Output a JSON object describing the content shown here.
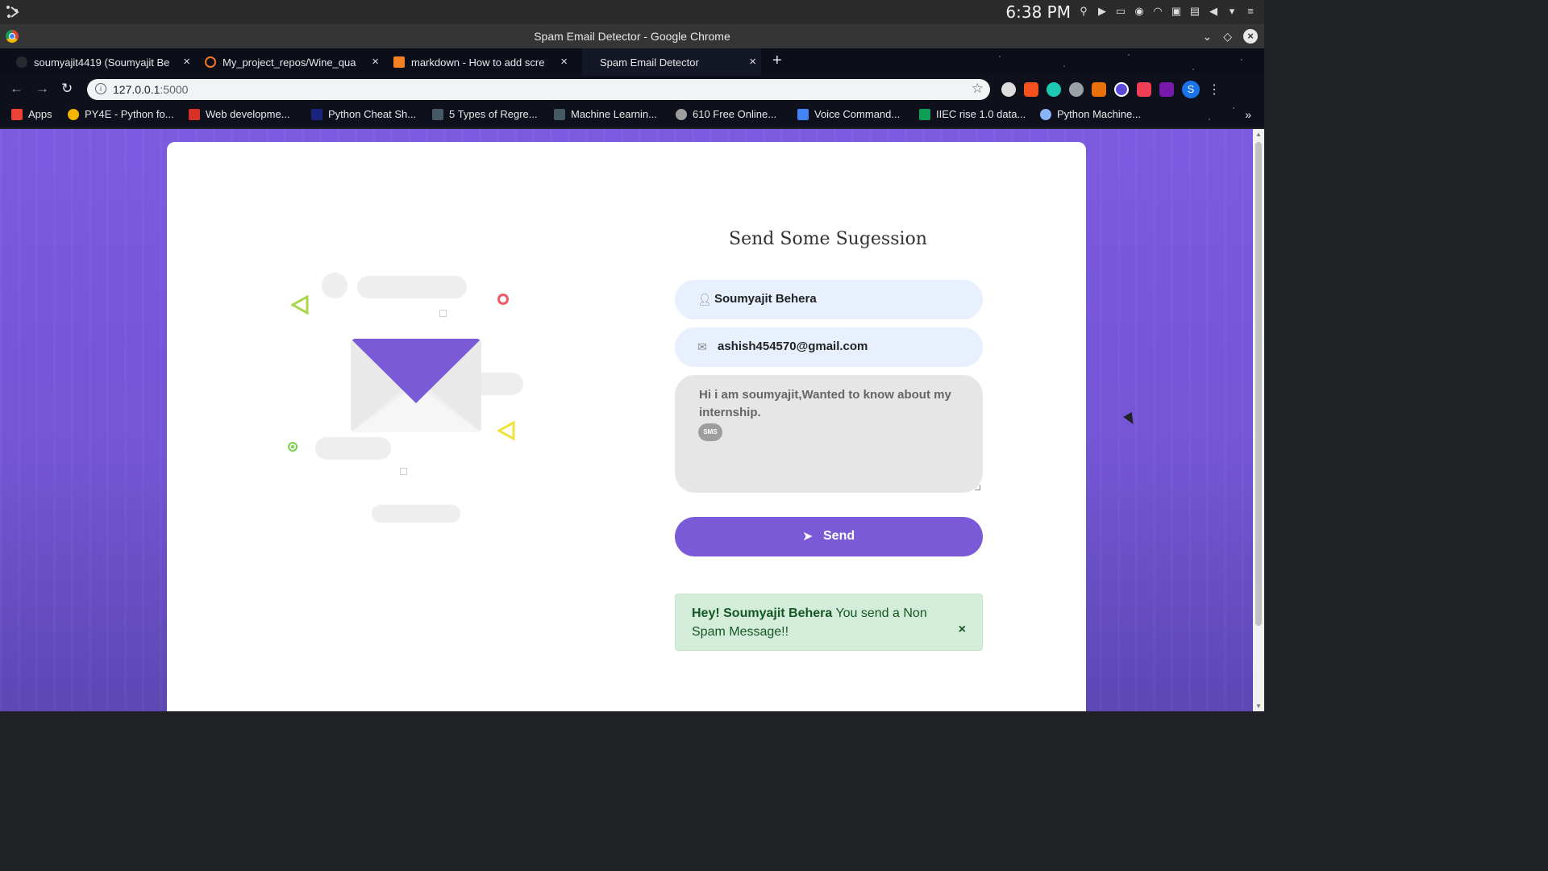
{
  "os": {
    "time": "6:38 PM"
  },
  "window": {
    "title": "Spam Email Detector - Google Chrome"
  },
  "tabs": [
    {
      "label": "soumyajit4419 (Soumyajit Be",
      "favicon_color": "#24292e"
    },
    {
      "label": "My_project_repos/Wine_qua",
      "favicon_color": "#f37626"
    },
    {
      "label": "markdown - How to add scre",
      "favicon_color": "#f48024"
    },
    {
      "label": "Spam Email Detector",
      "favicon_color": "#0c0f1a"
    }
  ],
  "address": {
    "host": "127.0.0.1",
    "port": ":5000"
  },
  "bookmarks": [
    {
      "label": "Apps",
      "color": "#ea4335"
    },
    {
      "label": "PY4E - Python fo...",
      "color": "#f4b400"
    },
    {
      "label": "Web developme...",
      "color": "#d93025"
    },
    {
      "label": "Python Cheat Sh...",
      "color": "#1a237e"
    },
    {
      "label": "5 Types of Regre...",
      "color": "#455a64"
    },
    {
      "label": "Machine Learnin...",
      "color": "#455a64"
    },
    {
      "label": "610 Free Online...",
      "color": "#9e9e9e"
    },
    {
      "label": "Voice Command...",
      "color": "#4285f4"
    },
    {
      "label": "IIEC rise 1.0 data...",
      "color": "#0f9d58"
    },
    {
      "label": "Python Machine...",
      "color": "#8ab4f8"
    }
  ],
  "form": {
    "title": "Send Some Sugession",
    "name_value": "Soumyajit Behera",
    "email_value": "ashish454570@gmail.com",
    "message_value": "Hi i am soumyajit,Wanted to know about my internship.",
    "sms_label": "SMS",
    "send_label": "Send"
  },
  "alert": {
    "greeting": "Hey! Soumyajit Behera",
    "message": " You send a Non Spam Message!!",
    "close": "×"
  },
  "colors": {
    "accent": "#7b5ad8",
    "alert_bg": "#d4edda",
    "alert_text": "#155724"
  }
}
